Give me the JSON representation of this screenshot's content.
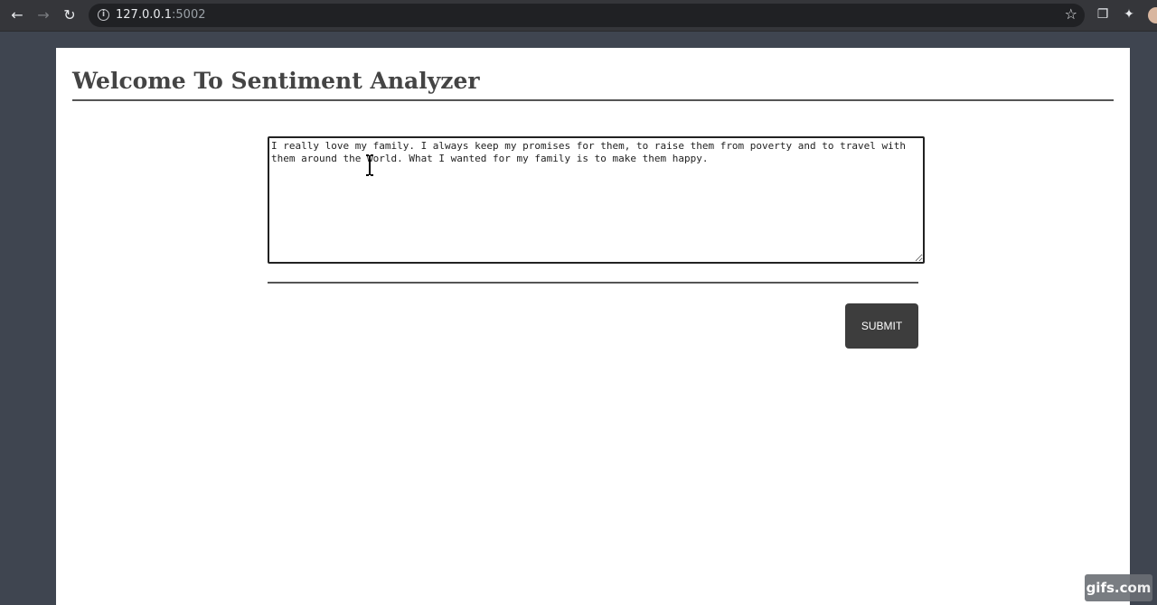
{
  "browser": {
    "url_host": "127.0.0.1",
    "url_port": ":5002",
    "icons": {
      "back": "arrow-left-icon",
      "forward": "arrow-right-icon",
      "reload": "reload-icon",
      "site_info": "info-icon",
      "bookmark": "star-icon",
      "extensions": "puzzle-icon"
    }
  },
  "page": {
    "title": "Welcome To Sentiment Analyzer",
    "textarea_value": "I really love my family. I always keep my promises for them, to raise them from poverty and to travel with them around the world. What I wanted for my family is to make them happy.",
    "submit_label": "SUBMIT"
  },
  "watermark": {
    "text": "gifs.com"
  },
  "colors": {
    "chrome_bg": "#35363a",
    "page_bg": "#3f4550",
    "button_bg": "#3d3d3d",
    "title_color": "#444444"
  }
}
